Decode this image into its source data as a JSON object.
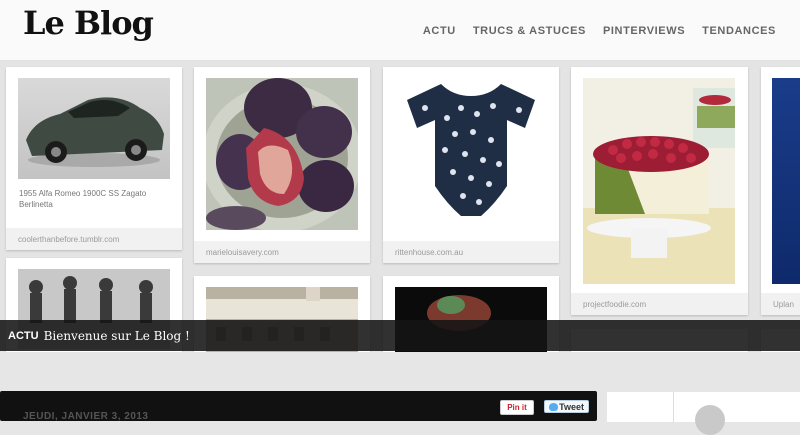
{
  "site": {
    "logo": "Le Blog"
  },
  "nav": [
    "ACTU",
    "TRUCS & ASTUCES",
    "PINTERVIEWS",
    "TENDANCES"
  ],
  "cards": {
    "car": {
      "caption_line1": "1955 Alfa Romeo 1900C SS Zagato",
      "caption_line2": "Berlinetta",
      "source": "coolerthanbefore.tumblr.com"
    },
    "figs": {
      "source": "marielouisavery.com"
    },
    "onesie": {
      "source": "rittenhouse.com.au"
    },
    "cake": {
      "source": "projectfoodie.com"
    },
    "blue": {
      "source": "Uplan"
    }
  },
  "caption": {
    "tag": "ACTU",
    "title": "Bienvenue sur Le Blog !"
  },
  "post": {
    "date": "JEUDI, JANVIER 3, 2013"
  },
  "share": {
    "pin": "Pin it",
    "tweet": "Tweet"
  },
  "colors": {
    "header_bg": "#fafafa",
    "caption_bg": "#141414",
    "nav_text": "#666666"
  }
}
